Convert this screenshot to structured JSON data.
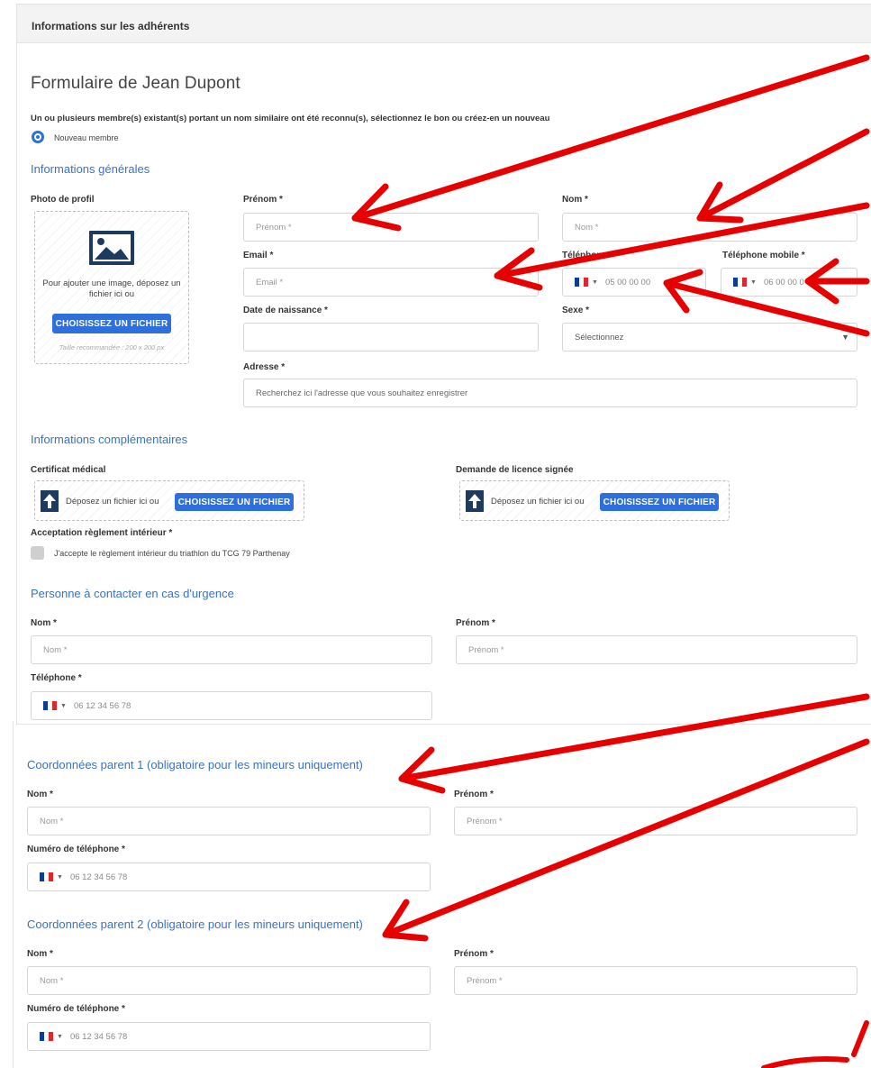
{
  "panel": {
    "header_title": "Informations sur les adhérents"
  },
  "form": {
    "title": "Formulaire de Jean Dupont",
    "similar_note": "Un ou plusieurs membre(s) existant(s) portant un nom similaire ont été reconnu(s), sélectionnez le bon ou créez-en un nouveau",
    "new_member_label": "Nouveau membre"
  },
  "general": {
    "title": "Informations générales",
    "photo_label": "Photo de profil",
    "photo_drop_text": "Pour ajouter une image, déposez un fichier ici ou",
    "photo_button": "CHOISISSEZ UN FICHIER",
    "photo_hint": "Taille recommandée : 200 x 200 px",
    "firstname_label": "Prénom *",
    "firstname_placeholder": "Prénom *",
    "lastname_label": "Nom *",
    "lastname_placeholder": "Nom *",
    "email_label": "Email *",
    "email_placeholder": "Email *",
    "phone_label": "Téléphone *",
    "phone_value": "05 00 00 00",
    "mobile_label": "Téléphone mobile *",
    "mobile_value": "06 00 00 0",
    "birthdate_label": "Date de naissance *",
    "sex_label": "Sexe *",
    "sex_value": "Sélectionnez",
    "address_label": "Adresse *",
    "address_placeholder": "Recherchez ici l'adresse que vous souhaitez enregistrer"
  },
  "complementary": {
    "title": "Informations complémentaires",
    "certificate_label": "Certificat médical",
    "license_label": "Demande de licence signée",
    "drop_text": "Déposez un fichier ici ou",
    "drop_button": "CHOISISSEZ UN FICHIER",
    "rules_label": "Acceptation règlement intérieur *",
    "rules_checkbox_text": "J'accepte le règlement intérieur du triathlon du TCG 79 Parthenay"
  },
  "emergency": {
    "title": "Personne à contacter en cas d'urgence",
    "lastname_label": "Nom *",
    "lastname_placeholder": "Nom *",
    "firstname_label": "Prénom *",
    "firstname_placeholder": "Prénom *",
    "phone_label": "Téléphone *",
    "phone_value": "06 12 34 56 78"
  },
  "parent1": {
    "title": "Coordonnées parent 1 (obligatoire pour les mineurs uniquement)",
    "lastname_label": "Nom *",
    "lastname_placeholder": "Nom *",
    "firstname_label": "Prénom *",
    "firstname_placeholder": "Prénom *",
    "phone_label": "Numéro de téléphone *",
    "phone_value": "06 12 34 56 78"
  },
  "parent2": {
    "title": "Coordonnées parent 2 (obligatoire pour les mineurs uniquement)",
    "lastname_label": "Nom *",
    "lastname_placeholder": "Nom *",
    "firstname_label": "Prénom *",
    "firstname_placeholder": "Prénom *",
    "phone_label": "Numéro de téléphone *",
    "phone_value": "06 12 34 56 78"
  },
  "colors": {
    "accent": "#2e6fdc",
    "section_title": "#3a72c4",
    "annotation_arrow": "#e60000"
  },
  "icons": [
    "image-icon",
    "upload-icon",
    "flag-fr-icon",
    "chevron-down-icon",
    "red-arrow-annotation"
  ]
}
